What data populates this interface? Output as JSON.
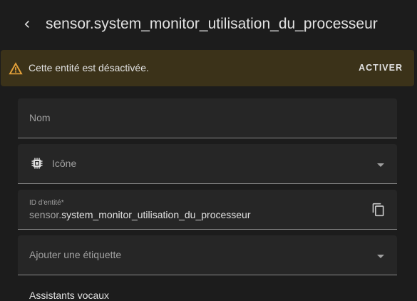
{
  "header": {
    "title": "sensor.system_monitor_utilisation_du_processeur"
  },
  "alert": {
    "message": "Cette entité est désactivée.",
    "action_label": "ACTIVER",
    "icon": "warning-icon",
    "color": "#e5a23a"
  },
  "form": {
    "name_label": "Nom",
    "icon_label": "Icône",
    "icon_name": "chip-icon",
    "entity_id_label": "ID d'entité*",
    "entity_id_prefix": "sensor.",
    "entity_id_value": "system_monitor_utilisation_du_processeur",
    "label_placeholder": "Ajouter une étiquette",
    "voice_assistants_heading": "Assistants vocaux"
  }
}
